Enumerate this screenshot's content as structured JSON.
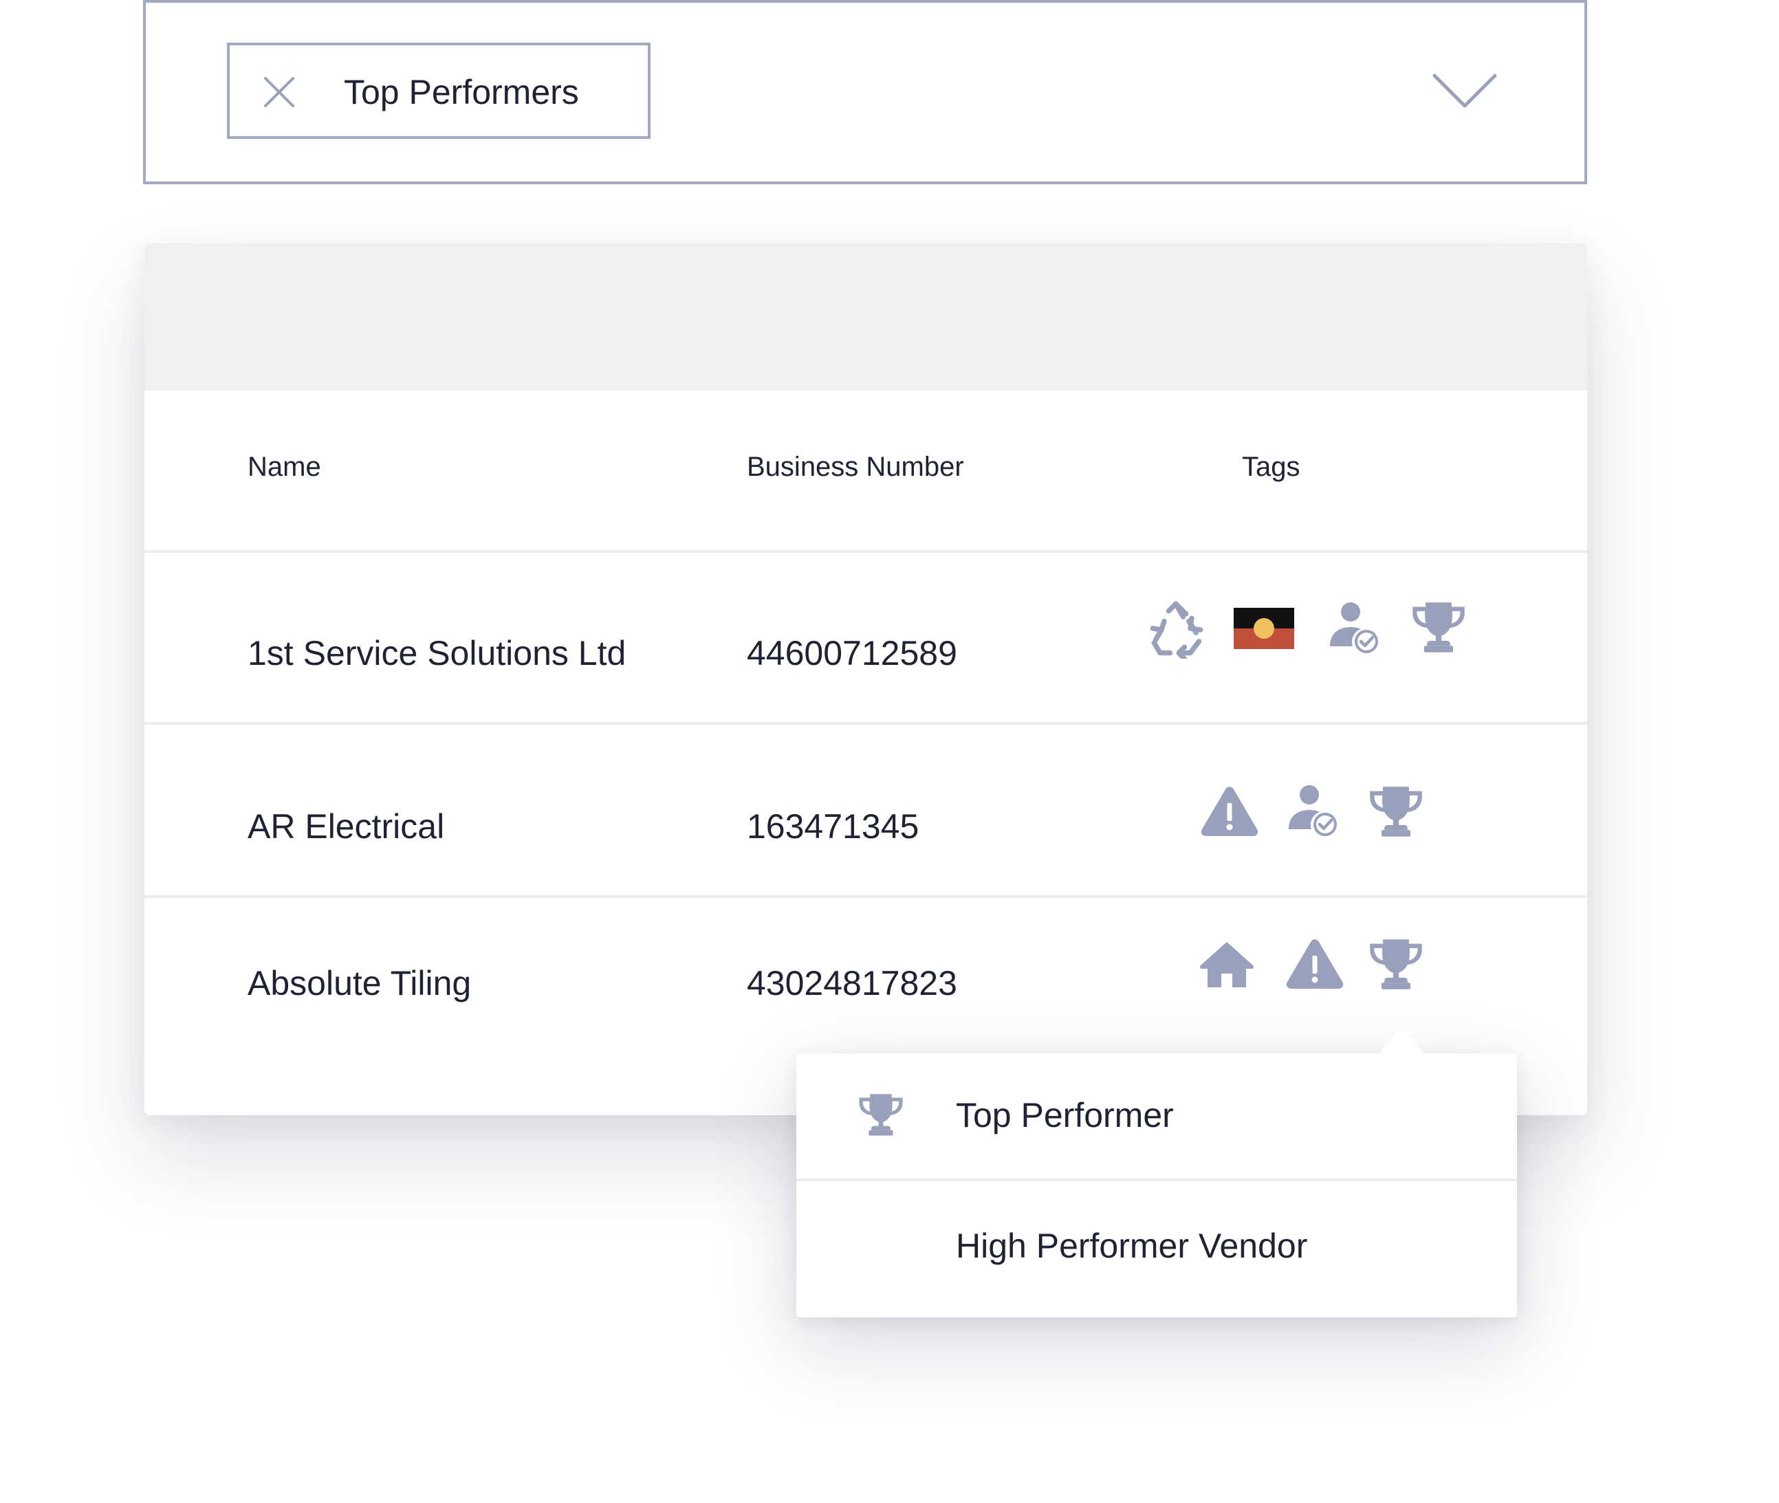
{
  "filter": {
    "chip_label": "Top Performers",
    "chip_close_icon": "close-icon",
    "dropdown_icon": "chevron-down-icon"
  },
  "table": {
    "columns": {
      "name": "Name",
      "business_number": "Business Number",
      "tags": "Tags"
    },
    "rows": [
      {
        "name": "1st Service Solutions Ltd",
        "business_number": "44600712589",
        "tags": [
          "recycle-icon",
          "aboriginal-flag-icon",
          "verified-user-icon",
          "trophy-icon"
        ]
      },
      {
        "name": "AR Electrical",
        "business_number": "163471345",
        "tags": [
          "warning-icon",
          "verified-user-icon",
          "trophy-icon"
        ]
      },
      {
        "name": "Absolute Tiling",
        "business_number": "43024817823",
        "tags": [
          "home-icon",
          "warning-icon",
          "trophy-icon"
        ]
      }
    ]
  },
  "popover": {
    "items": [
      {
        "label": "Top Performer",
        "icon": "trophy-icon"
      },
      {
        "label": "High Performer Vendor"
      }
    ]
  },
  "colors": {
    "icon": "#98a0bb",
    "border": "#a3a9be",
    "text": "#1f2233",
    "header_band": "#f0f0f0",
    "flag_black": "#111111",
    "flag_red": "#c0503a",
    "flag_yellow": "#f0c060"
  }
}
